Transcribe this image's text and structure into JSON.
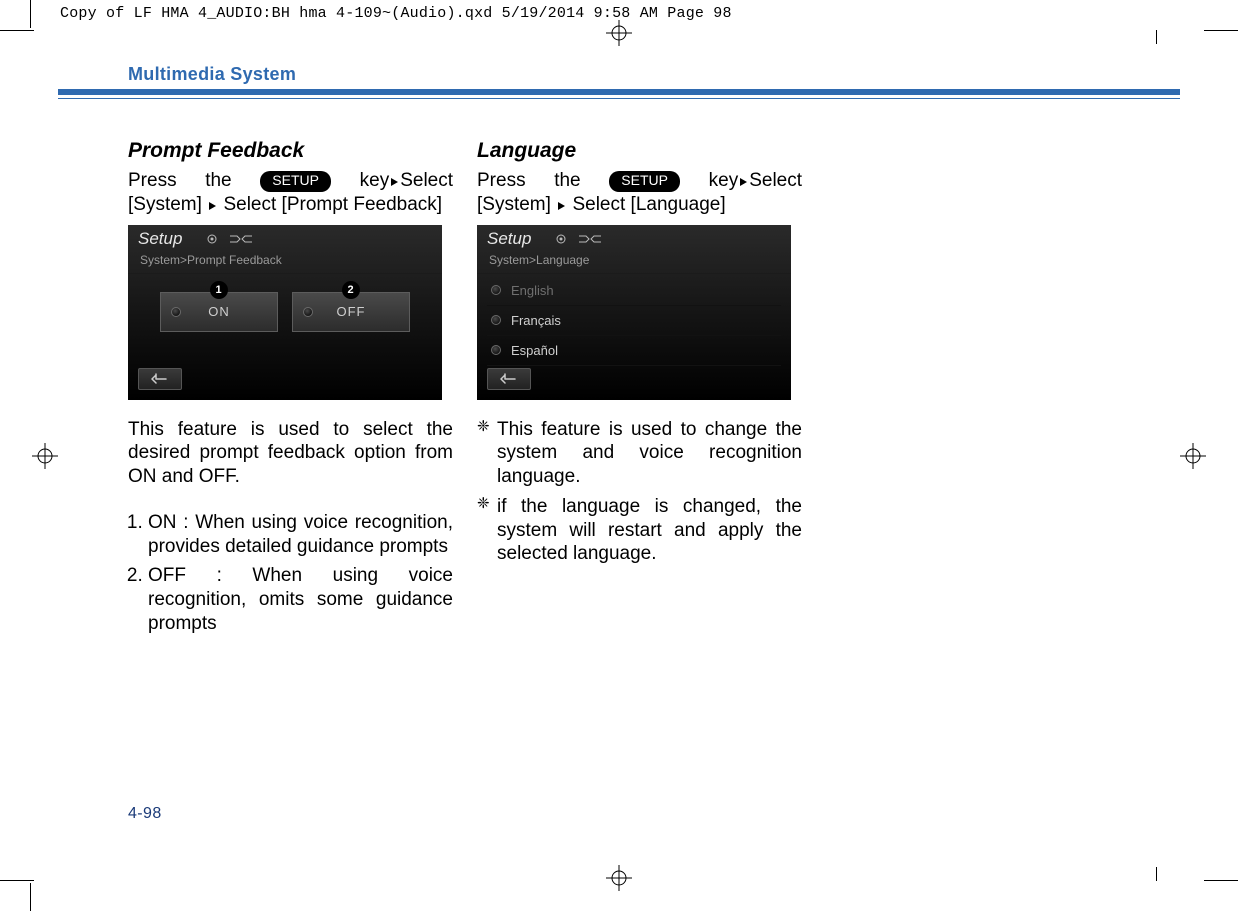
{
  "printer": {
    "slug": "Copy of LF HMA 4_AUDIO:BH hma 4-109~(Audio).qxd  5/19/2014  9:58 AM  Page 98"
  },
  "runningHead": "Multimedia System",
  "folio": "4-98",
  "setupKeyLabel": "SETUP",
  "arrowGlyph": "▶",
  "left": {
    "heading": "Prompt Feedback",
    "instr_parts": {
      "p1": "Press   the ",
      "p2": " key",
      "p3": "Select [System] ",
      "p4": " Select [Prompt Feedback]"
    },
    "screenshot": {
      "title": "Setup",
      "crumb": "System>Prompt Feedback",
      "on": "ON",
      "off": "OFF",
      "callout1": "1",
      "callout2": "2"
    },
    "paragraph": "This feature is used to select the desired prompt feedback option from ON and OFF.",
    "items": [
      "ON : When using voice recognition, provides detailed guidance prompts",
      "OFF : When using voice recognition, omits some guidance prompts"
    ]
  },
  "right": {
    "heading": "Language",
    "instr_parts": {
      "p1": "Press   the ",
      "p2": " key",
      "p3": "Select [System] ",
      "p4": " Select [Language]"
    },
    "screenshot": {
      "title": "Setup",
      "crumb": "System>Language",
      "langs": [
        "English",
        "Français",
        "Español"
      ]
    },
    "notes": [
      "This feature is used to change the system and voice recognition language.",
      "if the language is changed, the system will restart and apply the selected language."
    ]
  }
}
